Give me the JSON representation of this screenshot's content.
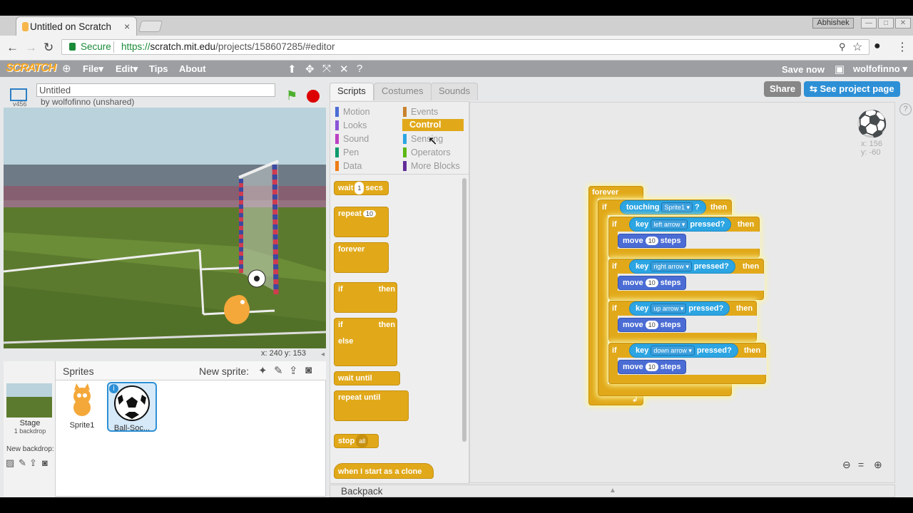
{
  "browser": {
    "tab_title": "Untitled on Scratch",
    "tab_close": "×",
    "profile_name": "Abhishek",
    "secure_label": "Secure",
    "url_scheme": "https://",
    "url_host": "scratch.mit.edu",
    "url_path": "/projects/158607285/#editor"
  },
  "menubar": {
    "logo": "SCRATCH",
    "file": "File",
    "edit": "Edit",
    "tips": "Tips",
    "about": "About",
    "save_now": "Save now",
    "username": "wolfofinno"
  },
  "project": {
    "title": "Untitled",
    "byline": "by wolfofinno (unshared)",
    "version": "v456",
    "stage_coords": "x: 240  y: 153"
  },
  "sprites_pane": {
    "heading": "Sprites",
    "new_sprite": "New sprite:",
    "stage_label": "Stage",
    "backdrop_count": "1 backdrop",
    "new_backdrop": "New backdrop:",
    "sprite_names": [
      "Sprite1",
      "Ball-Soc..."
    ]
  },
  "editor_tabs": {
    "scripts": "Scripts",
    "costumes": "Costumes",
    "sounds": "Sounds",
    "share": "Share",
    "see_project": "See project page"
  },
  "categories": {
    "motion": "Motion",
    "looks": "Looks",
    "sound": "Sound",
    "pen": "Pen",
    "data": "Data",
    "events": "Events",
    "control": "Control",
    "sensing": "Sensing",
    "operators": "Operators",
    "more_blocks": "More Blocks"
  },
  "palette_blocks": {
    "wait": "wait",
    "wait_value": "1",
    "secs": "secs",
    "repeat": "repeat",
    "repeat_value": "10",
    "forever": "forever",
    "if": "if",
    "then": "then",
    "else": "else",
    "wait_until": "wait until",
    "repeat_until": "repeat until",
    "stop": "stop",
    "stop_option": "all",
    "clone": "when I start as a clone"
  },
  "script": {
    "forever": "forever",
    "if": "if",
    "then": "then",
    "touching": "touching",
    "touching_target": "Sprite1",
    "touching_q": "?",
    "key": "key",
    "pressed": "pressed?",
    "move": "move",
    "steps": "steps",
    "move_value": "10",
    "keys": [
      "left arrow",
      "right arrow",
      "up arrow",
      "down arrow"
    ]
  },
  "sprite_info": {
    "x": "x: 156",
    "y": "y: -60"
  },
  "backpack": "Backpack"
}
